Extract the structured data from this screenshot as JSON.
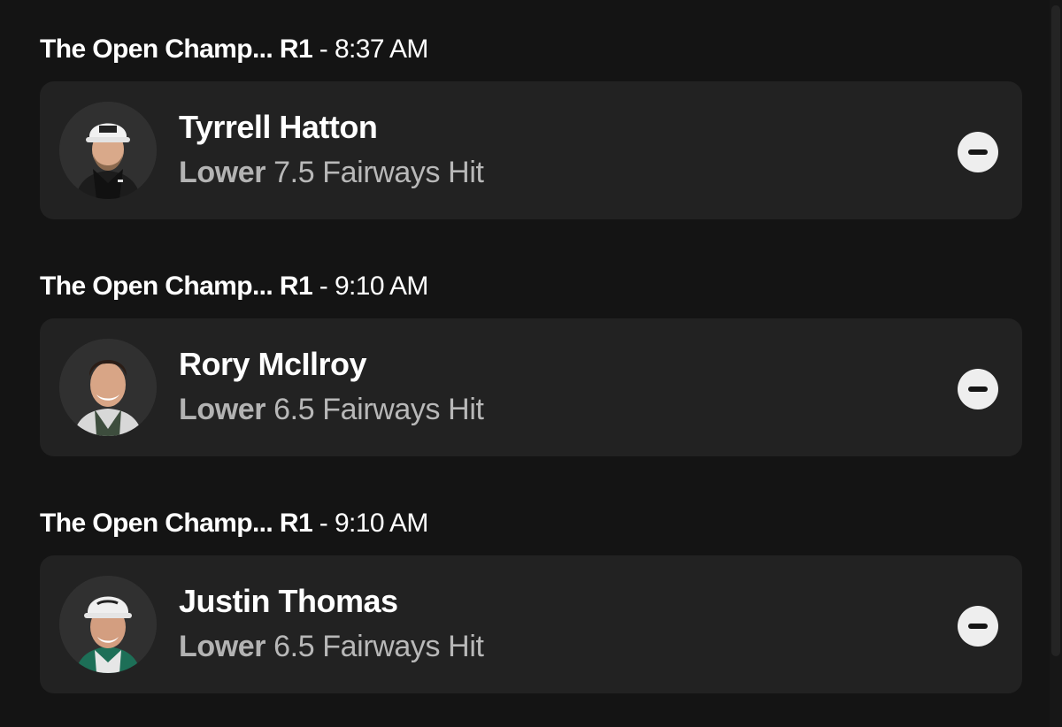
{
  "picks": [
    {
      "event": "The Open Champ...",
      "round": "R1",
      "separator": " - ",
      "time": "8:37 AM",
      "player": "Tyrrell Hatton",
      "direction": "Lower",
      "line": "7.5",
      "stat": "Fairways Hit",
      "avatar_icon": "player-headshot-icon",
      "remove_icon": "minus-circle-icon"
    },
    {
      "event": "The Open Champ...",
      "round": "R1",
      "separator": " - ",
      "time": "9:10 AM",
      "player": "Rory McIlroy",
      "direction": "Lower",
      "line": "6.5",
      "stat": "Fairways Hit",
      "avatar_icon": "player-headshot-icon",
      "remove_icon": "minus-circle-icon"
    },
    {
      "event": "The Open Champ...",
      "round": "R1",
      "separator": " - ",
      "time": "9:10 AM",
      "player": "Justin Thomas",
      "direction": "Lower",
      "line": "6.5",
      "stat": "Fairways Hit",
      "avatar_icon": "player-headshot-icon",
      "remove_icon": "minus-circle-icon"
    }
  ],
  "colors": {
    "background": "#141414",
    "card": "#222222",
    "primary_text": "#ffffff",
    "secondary_text": "#b8b8b8",
    "remove_button": "#eeeeee"
  }
}
